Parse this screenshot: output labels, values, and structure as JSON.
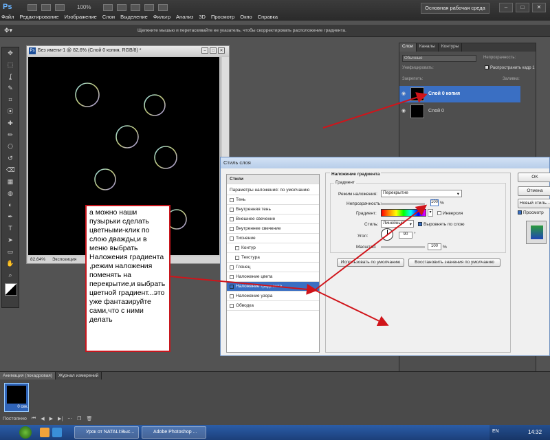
{
  "app": {
    "logo": "Ps",
    "zoom": "100%",
    "workspace_button": "Основная рабочая среда",
    "menu": [
      "Файл",
      "Редактирование",
      "Изображение",
      "Слои",
      "Выделение",
      "Фильтр",
      "Анализ",
      "3D",
      "Просмотр",
      "Окно",
      "Справка"
    ],
    "window_controls": [
      "–",
      "□",
      "✕"
    ]
  },
  "options_bar": {
    "hint": "Щелкните мышью и перетаскивайте ее указатель, чтобы скорректировать расположение градиента."
  },
  "tools": [
    "move",
    "marquee",
    "lasso",
    "quick-select",
    "crop",
    "eyedropper",
    "healing",
    "brush",
    "stamp",
    "history-brush",
    "eraser",
    "gradient",
    "blur",
    "dodge",
    "pen",
    "type",
    "path-select",
    "shape",
    "hand",
    "zoom"
  ],
  "document": {
    "ps_icon": "Ps",
    "title": "Без имени-1 @ 82,6% (Слой 0 копия, RGB/8) *",
    "zoom_status": "82,64%",
    "status_text": "Экспозиция",
    "controls": [
      "–",
      "□",
      "✕"
    ]
  },
  "layers_panel": {
    "tabs": [
      "Слои",
      "Каналы",
      "Контуры"
    ],
    "blend_mode": "Обычные",
    "opacity_label": "Непрозрачность:",
    "unify_label": "Унифицировать:",
    "spread_label": "Распространить кадр 1",
    "lock_label": "Закрепить:",
    "fill_label": "Заливка:",
    "layers": [
      {
        "name": "Слой 0 копия",
        "selected": true
      },
      {
        "name": "Слой 0",
        "selected": false
      }
    ]
  },
  "dialog": {
    "title": "Стиль слоя",
    "styles_header": "Стили",
    "blend_defaults": "Параметры наложения: по умолчанию",
    "styles": [
      {
        "label": "Тень",
        "checked": false,
        "indent": false,
        "selected": false
      },
      {
        "label": "Внутренняя тень",
        "checked": false,
        "indent": false,
        "selected": false
      },
      {
        "label": "Внешнее свечение",
        "checked": false,
        "indent": false,
        "selected": false
      },
      {
        "label": "Внутреннее свечение",
        "checked": false,
        "indent": false,
        "selected": false
      },
      {
        "label": "Тиснение",
        "checked": false,
        "indent": false,
        "selected": false
      },
      {
        "label": "Контур",
        "checked": false,
        "indent": true,
        "selected": false
      },
      {
        "label": "Текстура",
        "checked": false,
        "indent": true,
        "selected": false
      },
      {
        "label": "Глянец",
        "checked": false,
        "indent": false,
        "selected": false
      },
      {
        "label": "Наложение цвета",
        "checked": false,
        "indent": false,
        "selected": false
      },
      {
        "label": "Наложение градиента",
        "checked": true,
        "indent": false,
        "selected": true
      },
      {
        "label": "Наложение узора",
        "checked": false,
        "indent": false,
        "selected": false
      },
      {
        "label": "Обводка",
        "checked": false,
        "indent": false,
        "selected": false
      }
    ],
    "section_title": "Наложение градиента",
    "group_title": "Градиент",
    "blend_mode_label": "Режим наложения:",
    "blend_mode_value": "Перекрытие",
    "opacity_label": "Непрозрачность:",
    "opacity_value": "100",
    "percent": "%",
    "gradient_label": "Градиент:",
    "inverse_label": "Инверсия",
    "style_label": "Стиль:",
    "style_value": "Линейный",
    "align_label": "Выровнять по слою",
    "angle_label": "Угол:",
    "angle_value": "90",
    "degree": "°",
    "scale_label": "Масштаб:",
    "scale_value": "100",
    "btn_default": "Использовать по умолчанию",
    "btn_restore": "Восстановить значения по умолчанию",
    "btn_ok": "OK",
    "btn_cancel": "Отмена",
    "btn_new_style": "Новый стиль...",
    "preview_label": "Просмотр"
  },
  "animation_panel": {
    "tabs": [
      "Анимация (покадровая)",
      "Журнал измерений"
    ],
    "frame_time": "0 сек.",
    "loop": "Постоянно"
  },
  "taskbar": {
    "items": [
      "Урок от NATALI:Выс...",
      "Adobe Photoshop ..."
    ],
    "lang": "EN",
    "time": "14:32"
  },
  "annotation": {
    "text": "а можно наши пузырьки сделать цветными-клик по слою дважды,и в меню выбрать Наложения градиента ,режим наложения поменять на перекрытие,и выбрать цветной градиент...это уже фантазируйте сами,что с ними делать"
  },
  "colors": {
    "accent": "#3a6fc3",
    "annotation_border": "#c8161d",
    "arrow": "#d0141a"
  }
}
